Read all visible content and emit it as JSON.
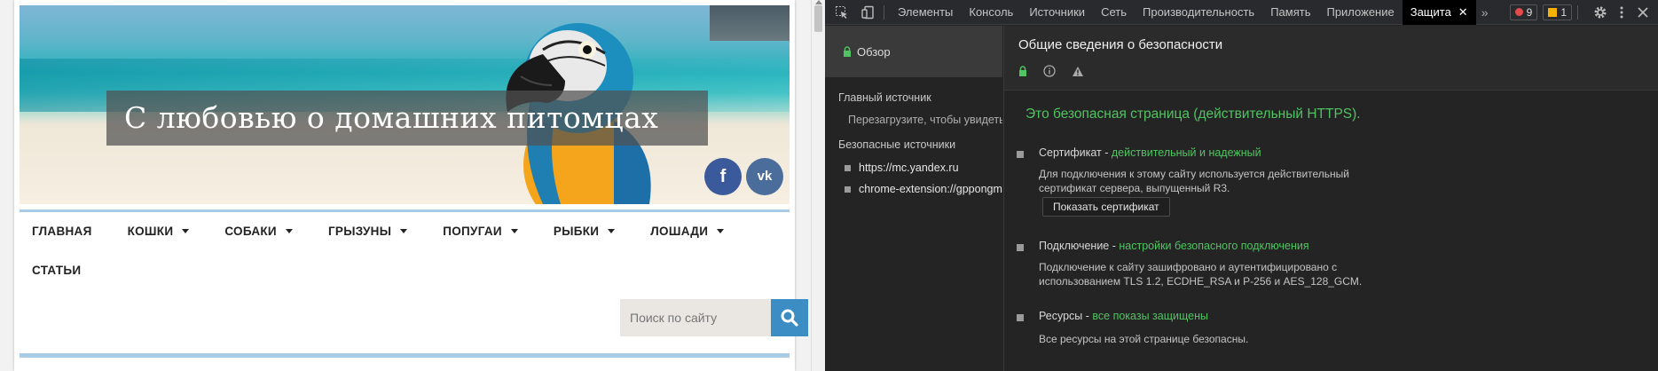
{
  "site": {
    "title": "С любовью о домашних питомцах",
    "social": {
      "fb": "f",
      "vk": "vk"
    },
    "nav": [
      {
        "label": "ГЛАВНАЯ",
        "has_caret": false
      },
      {
        "label": "КОШКИ",
        "has_caret": true
      },
      {
        "label": "СОБАКИ",
        "has_caret": true
      },
      {
        "label": "ГРЫЗУНЫ",
        "has_caret": true
      },
      {
        "label": "ПОПУГАИ",
        "has_caret": true
      },
      {
        "label": "РЫБКИ",
        "has_caret": true
      },
      {
        "label": "ЛОШАДИ",
        "has_caret": true
      },
      {
        "label": "СТАТЬИ",
        "has_caret": false
      }
    ],
    "search": {
      "placeholder": "Поиск по сайту"
    },
    "colors": {
      "accent": "#3b8dc3",
      "nav_line": "#a8cce4",
      "fb": "#3b5a9b",
      "vk": "#4a6d9c"
    }
  },
  "devtools": {
    "tabs": [
      "Элементы",
      "Консоль",
      "Источники",
      "Сеть",
      "Производительность",
      "Память",
      "Приложение",
      "Защита"
    ],
    "active_tab": "Защита",
    "error_count": "9",
    "warning_count": "1",
    "sidebar": {
      "overview": "Обзор",
      "main_origin_heading": "Главный источник",
      "main_origin_hint": "Перезагрузите, чтобы увидеть подробные сведения",
      "secure_origins_heading": "Безопасные источники",
      "origins": [
        "https://mc.yandex.ru",
        "chrome-extension://gppongmhjkpfnbhagpmjfkannfbllamg"
      ]
    },
    "main": {
      "title": "Общие сведения о безопасности",
      "secure_message": "Это безопасная страница (действительный HTTPS).",
      "certificate": {
        "label": "Сертификат",
        "status": "действительный и надежный",
        "line1": "Для подключения к этому сайту используется действительный",
        "line2": "сертификат сервера, выпущенный R3.",
        "button": "Показать сертификат"
      },
      "connection": {
        "label": "Подключение",
        "status": "настройки безопасного подключения",
        "line1": "Подключение к сайту зашифровано и аутентифицировано с",
        "line2": "использованием TLS 1.2, ECDHE_RSA и P-256 и AES_128_GCM."
      },
      "resources": {
        "label": "Ресурсы",
        "status": "все показы защищены",
        "line1": "Все ресурсы на этой странице безопасны."
      }
    },
    "colors": {
      "secure_green": "#4fc461",
      "error": "#e34b4b",
      "warning": "#f5b400"
    }
  }
}
